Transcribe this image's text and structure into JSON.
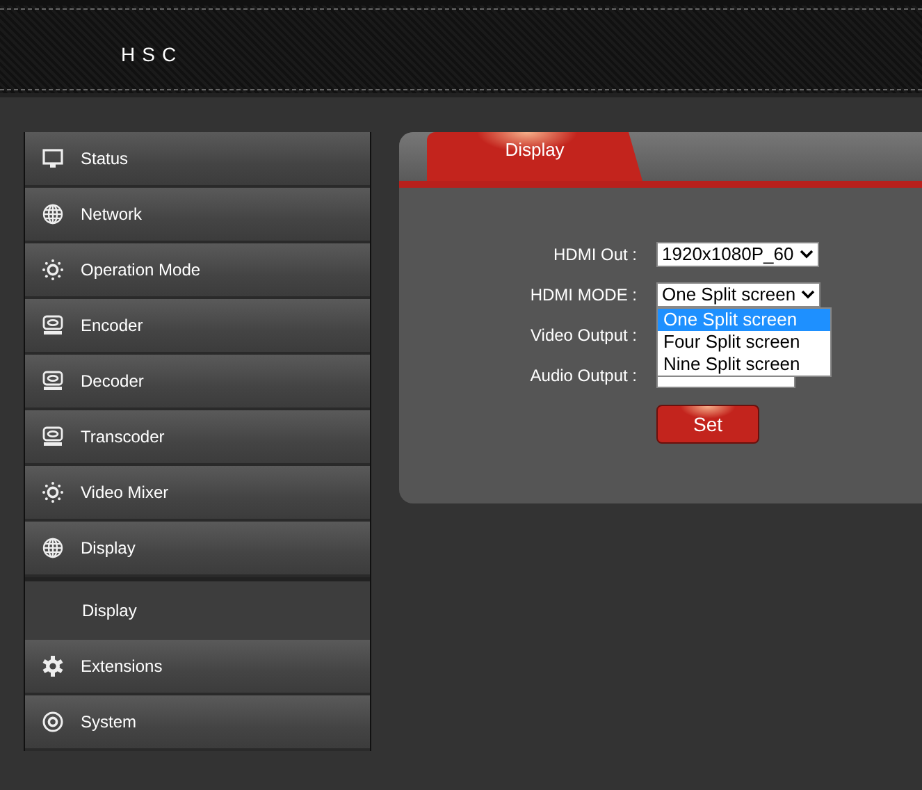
{
  "header": {
    "brand": "HSC"
  },
  "sidebar": {
    "items": [
      {
        "label": "Status",
        "kind": "monitor"
      },
      {
        "label": "Network",
        "kind": "globe"
      },
      {
        "label": "Operation Mode",
        "kind": "dots"
      },
      {
        "label": "Encoder",
        "kind": "disk"
      },
      {
        "label": "Decoder",
        "kind": "disk"
      },
      {
        "label": "Transcoder",
        "kind": "disk"
      },
      {
        "label": "Video Mixer",
        "kind": "dots"
      },
      {
        "label": "Display",
        "kind": "globe",
        "children": [
          {
            "label": "Display"
          }
        ]
      },
      {
        "label": "Extensions",
        "kind": "gear"
      },
      {
        "label": "System",
        "kind": "target"
      }
    ]
  },
  "panel": {
    "tabs": [
      {
        "label": "Display",
        "selected": true
      }
    ],
    "fields": [
      {
        "label": "HDMI Out :",
        "value": "1920x1080P_60"
      },
      {
        "label": "HDMI MODE :",
        "value": "One Split screen",
        "open": true,
        "options": [
          {
            "label": "One Split screen",
            "selected": true
          },
          {
            "label": "Four Split screen",
            "selected": false
          },
          {
            "label": "Nine Split screen",
            "selected": false
          }
        ]
      },
      {
        "label": "Video Output :"
      },
      {
        "label": "Audio Output :"
      }
    ],
    "button": "Set"
  }
}
